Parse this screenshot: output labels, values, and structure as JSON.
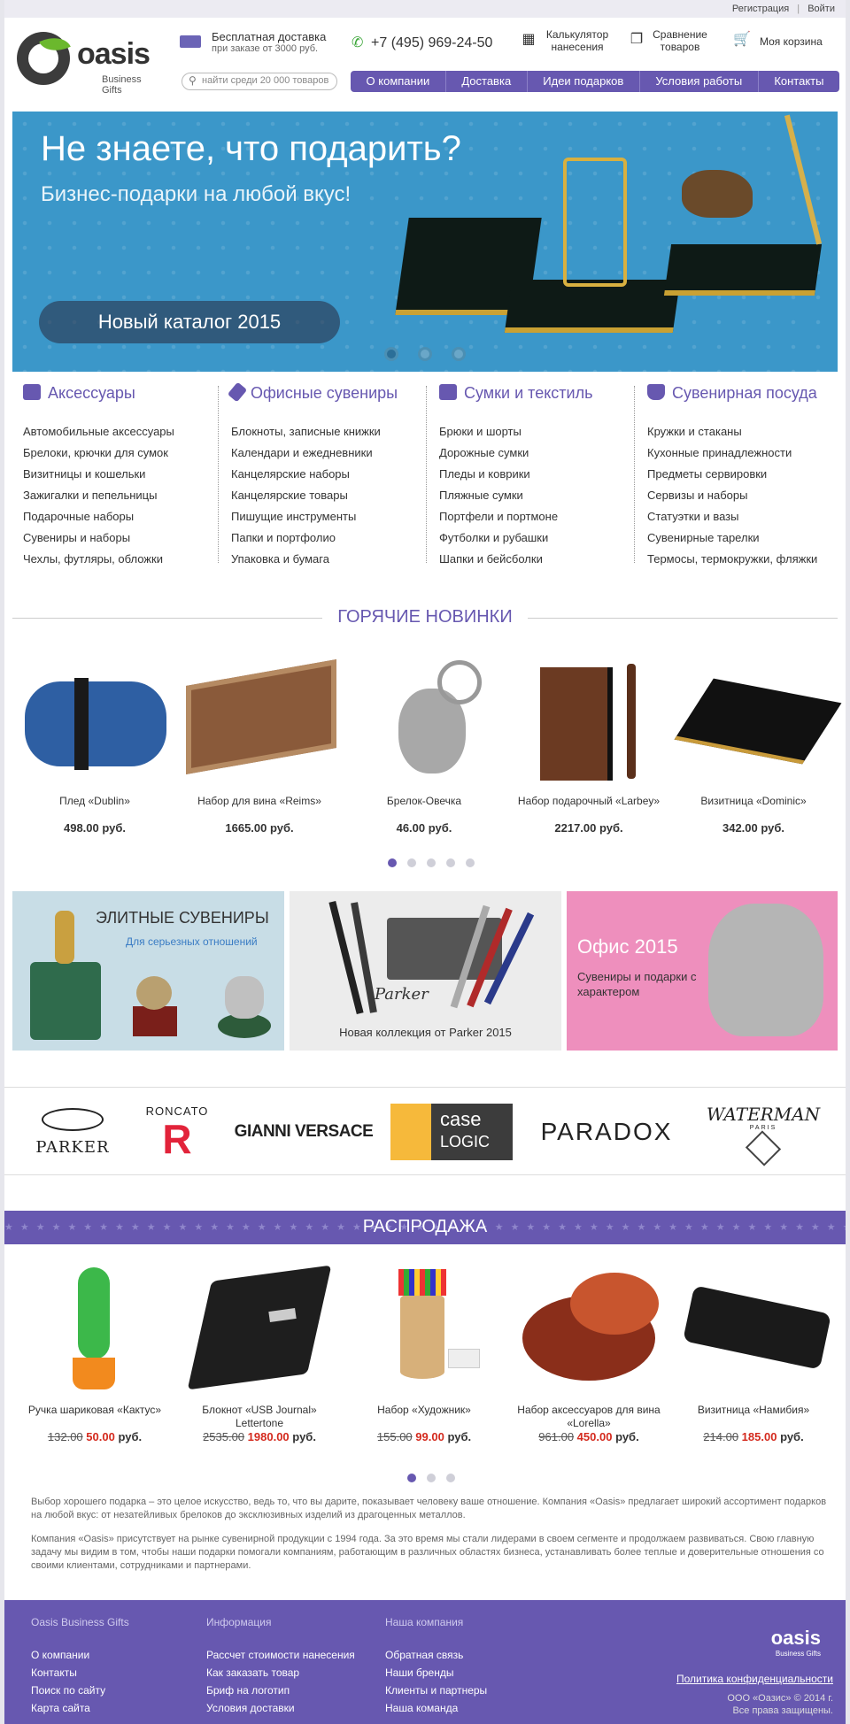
{
  "topbar": {
    "register": "Регистрация",
    "sep": "|",
    "login": "Войти"
  },
  "logo": {
    "name": "oasis",
    "sub": "Business Gifts"
  },
  "header": {
    "delivery_title": "Бесплатная доставка",
    "delivery_sub": "при заказе от 3000 руб.",
    "phone": "+7 (495) 969-24-50",
    "calc_line1": "Калькулятор",
    "calc_line2": "нанесения",
    "compare_line1": "Сравнение",
    "compare_line2": "товаров",
    "cart": "Моя корзина",
    "search_placeholder": "найти среди 20 000 товаров"
  },
  "nav": [
    "О компании",
    "Доставка",
    "Идеи подарков",
    "Условия работы",
    "Контакты"
  ],
  "hero": {
    "title": "Не знаете, что подарить?",
    "subtitle": "Бизнес-подарки на любой вкус!",
    "button": "Новый каталог 2015"
  },
  "categories": [
    {
      "title": "Аксессуары",
      "items": [
        "Автомобильные аксессуары",
        "Брелоки, крючки для сумок",
        "Визитницы и кошельки",
        "Зажигалки и пепельницы",
        "Подарочные наборы",
        "Сувениры и наборы",
        "Чехлы, футляры, обложки"
      ]
    },
    {
      "title": "Офисные сувениры",
      "items": [
        "Блокноты, записные книжки",
        "Календари и ежедневники",
        "Канцелярские наборы",
        "Канцелярские товары",
        "Пишущие инструменты",
        "Папки и портфолио",
        "Упаковка и бумага"
      ]
    },
    {
      "title": "Сумки и текстиль",
      "items": [
        "Брюки и шорты",
        "Дорожные сумки",
        "Пледы и коврики",
        "Пляжные сумки",
        "Портфели и портмоне",
        "Футболки и рубашки",
        "Шапки и бейсболки"
      ]
    },
    {
      "title": "Сувенирная посуда",
      "items": [
        "Кружки и стаканы",
        "Кухонные принадлежности",
        "Предметы сервировки",
        "Сервизы и наборы",
        "Статуэтки и вазы",
        "Сувенирные тарелки",
        "Термосы, термокружки, фляжки"
      ]
    }
  ],
  "hot": {
    "title": "ГОРЯЧИЕ НОВИНКИ",
    "products": [
      {
        "name": "Плед «Dublin»",
        "price": "498.00 руб."
      },
      {
        "name": "Набор для вина «Reims»",
        "price": "1665.00 руб."
      },
      {
        "name": "Брелок-Овечка",
        "price": "46.00 руб."
      },
      {
        "name": "Набор подарочный «Larbey»",
        "price": "2217.00 руб."
      },
      {
        "name": "Визитница «Dominic»",
        "price": "342.00 руб."
      }
    ]
  },
  "banners": {
    "elite_title": "ЭЛИТНЫЕ СУВЕНИРЫ",
    "elite_sub": "Для серьезных отношений",
    "parker_caption": "Новая коллекция от Parker 2015",
    "parker_script": "Parker",
    "office_title": "Офис 2015",
    "office_sub": "Сувениры и подарки с характером"
  },
  "brands": {
    "parker": "PARKER",
    "roncato": "RONCATO",
    "versace": "GIANNI VERSACE",
    "caselogic_1": "case",
    "caselogic_2": "LOGIC",
    "paradox": "PARADOX",
    "waterman": "WATERMAN",
    "waterman_sub": "PARIS"
  },
  "sale": {
    "title": "РАСПРОДАЖА",
    "currency": "руб.",
    "products": [
      {
        "name": "Ручка шариковая «Кактус»",
        "old": "132.00",
        "new": "50.00"
      },
      {
        "name": "Блокнот «USB Journal» Lettertone",
        "old": "2535.00",
        "new": "1980.00"
      },
      {
        "name": "Набор «Художник»",
        "old": "155.00",
        "new": "99.00"
      },
      {
        "name": "Набор аксессуаров для вина «Lorella»",
        "old": "961.00",
        "new": "450.00"
      },
      {
        "name": "Визитница «Намибия»",
        "old": "214.00",
        "new": "185.00"
      }
    ]
  },
  "about": {
    "p1": "Выбор хорошего подарка – это целое искусство, ведь то, что вы дарите, показывает человеку ваше отношение. Компания «Oasis» предлагает широкий ассортимент подарков на любой вкус: от незатейливых брелоков до эксклюзивных изделий из драгоценных металлов.",
    "p2": "Компания «Oasis» присутствует на рынке сувенирной продукции с 1994 года. За это время мы стали лидерами в своем сегменте и продолжаем развиваться. Свою главную задачу мы видим в том, чтобы наши подарки помогали компаниям, работающим в различных областях бизнеса, устанавливать более теплые и доверительные отношения со своими клиентами, сотрудниками и партнерами."
  },
  "footer": {
    "col1": {
      "title": "Oasis Business Gifts",
      "links": [
        "О компании",
        "Контакты",
        "Поиск по сайту",
        "Карта сайта"
      ]
    },
    "col2": {
      "title": "Информация",
      "links": [
        "Рассчет стоимости нанесения",
        "Как заказать товар",
        "Бриф на логотип",
        "Условия доставки"
      ]
    },
    "col3": {
      "title": "Наша компания",
      "links": [
        "Обратная связь",
        "Наши бренды",
        "Клиенты и партнеры",
        "Наша команда"
      ]
    },
    "logo": "oasis",
    "logo_sub": "Business Gifts",
    "policy": "Политика конфиденциальности",
    "copy1": "ООО «Оазис» © 2014 г.",
    "copy2": "Все права защищены."
  },
  "colors": {
    "accent": "#6758b0",
    "sale_price": "#d42a1e",
    "phone_icon": "#3aa537",
    "hero_bg": "#3b97c9"
  }
}
